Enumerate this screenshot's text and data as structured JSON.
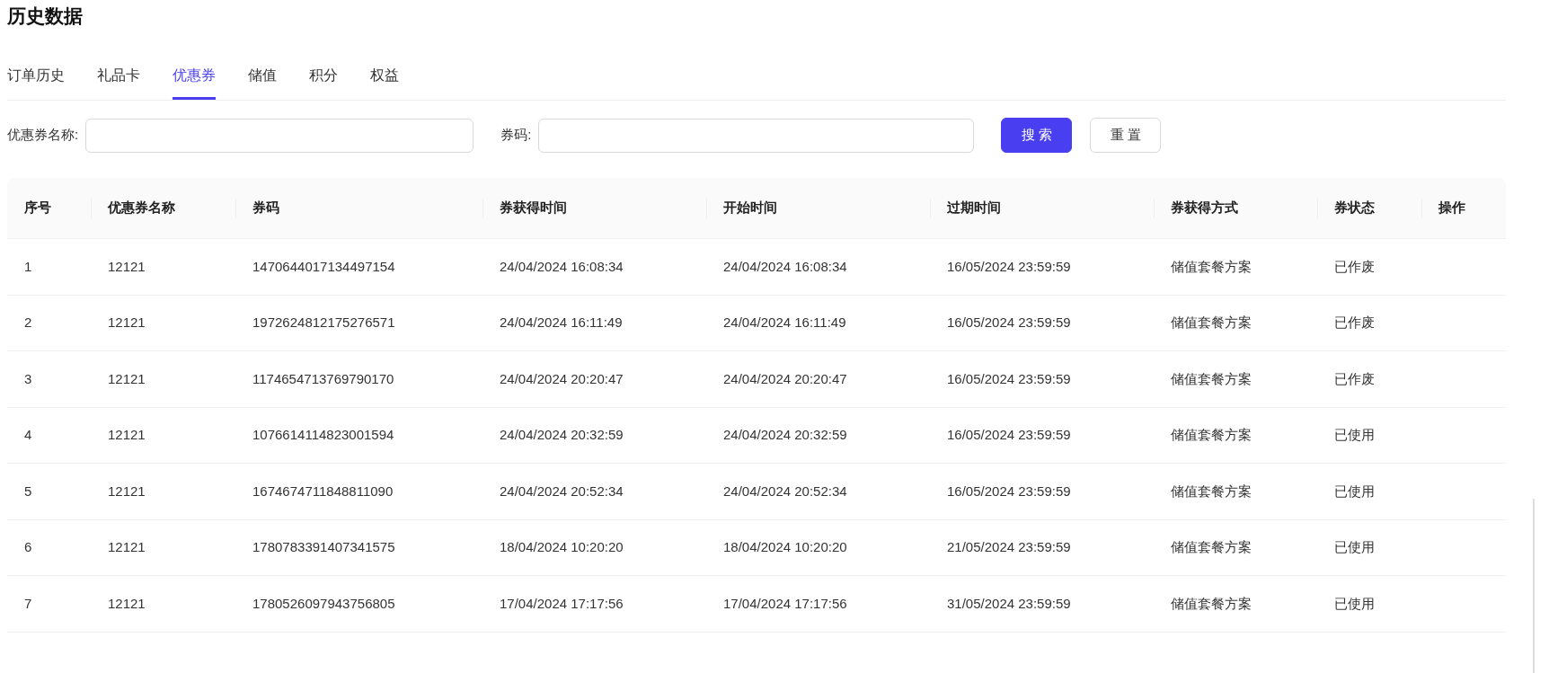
{
  "page_title": "历史数据",
  "tabs": [
    {
      "label": "订单历史",
      "selected": false
    },
    {
      "label": "礼品卡",
      "selected": false
    },
    {
      "label": "优惠券",
      "selected": true
    },
    {
      "label": "储值",
      "selected": false
    },
    {
      "label": "积分",
      "selected": false
    },
    {
      "label": "权益",
      "selected": false
    }
  ],
  "filters": [
    {
      "label": "优惠券名称:"
    },
    {
      "label": "券码:"
    }
  ],
  "buttons": [
    {
      "label": "搜 索",
      "kind": "primary"
    },
    {
      "label": "重 置",
      "kind": "default"
    }
  ],
  "table": {
    "columns": [
      "序号",
      "优惠券名称",
      "券码",
      "券获得时间",
      "开始时间",
      "过期时间",
      "券获得方式",
      "券状态",
      "操作"
    ],
    "rows": [
      [
        "1",
        "12121",
        "1470644017134497154",
        "24/04/2024 16:08:34",
        "24/04/2024 16:08:34",
        "16/05/2024 23:59:59",
        "储值套餐方案",
        "已作废"
      ],
      [
        "2",
        "12121",
        "1972624812175276571",
        "24/04/2024 16:11:49",
        "24/04/2024 16:11:49",
        "16/05/2024 23:59:59",
        "储值套餐方案",
        "已作废"
      ],
      [
        "3",
        "12121",
        "1174654713769790170",
        "24/04/2024 20:20:47",
        "24/04/2024 20:20:47",
        "16/05/2024 23:59:59",
        "储值套餐方案",
        "已作废"
      ],
      [
        "4",
        "12121",
        "1076614114823001594",
        "24/04/2024 20:32:59",
        "24/04/2024 20:32:59",
        "16/05/2024 23:59:59",
        "储值套餐方案",
        "已使用"
      ],
      [
        "5",
        "12121",
        "1674674711848811090",
        "24/04/2024 20:52:34",
        "24/04/2024 20:52:34",
        "16/05/2024 23:59:59",
        "储值套餐方案",
        "已使用"
      ],
      [
        "6",
        "12121",
        "1780783391407341575",
        "18/04/2024 10:20:20",
        "18/04/2024 10:20:20",
        "21/05/2024 23:59:59",
        "储值套餐方案",
        "已使用"
      ],
      [
        "7",
        "12121",
        "1780526097943756805",
        "17/04/2024 17:17:56",
        "17/04/2024 17:17:56",
        "31/05/2024 23:59:59",
        "储值套餐方案",
        "已使用"
      ]
    ]
  }
}
